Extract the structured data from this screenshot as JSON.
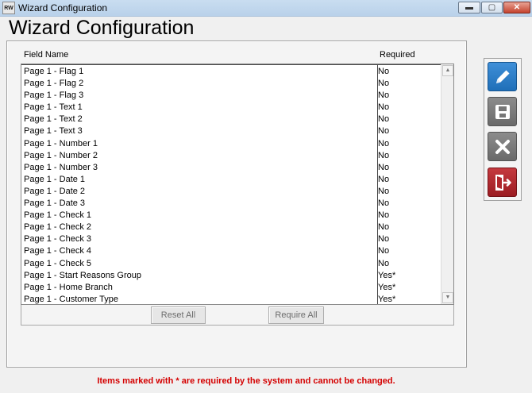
{
  "window": {
    "app_icon_text": "RW",
    "title": "Wizard Configuration",
    "controls": {
      "minimize": "▬",
      "maximize": "▢",
      "close": "✕"
    }
  },
  "page": {
    "heading": "Wizard Configuration"
  },
  "table": {
    "columns": {
      "field": "Field Name",
      "required": "Required"
    },
    "rows": [
      {
        "field": "Page 1 - Flag 1",
        "required": "No"
      },
      {
        "field": "Page 1 - Flag 2",
        "required": "No"
      },
      {
        "field": "Page 1 - Flag 3",
        "required": "No"
      },
      {
        "field": "Page 1 - Text 1",
        "required": "No"
      },
      {
        "field": "Page 1 - Text 2",
        "required": "No"
      },
      {
        "field": "Page 1 - Text 3",
        "required": "No"
      },
      {
        "field": "Page 1 - Number 1",
        "required": "No"
      },
      {
        "field": "Page 1 - Number 2",
        "required": "No"
      },
      {
        "field": "Page 1 - Number 3",
        "required": "No"
      },
      {
        "field": "Page 1 - Date 1",
        "required": "No"
      },
      {
        "field": "Page 1 - Date 2",
        "required": "No"
      },
      {
        "field": "Page 1 - Date 3",
        "required": "No"
      },
      {
        "field": "Page 1 - Check 1",
        "required": "No"
      },
      {
        "field": "Page 1 - Check 2",
        "required": "No"
      },
      {
        "field": "Page 1 - Check 3",
        "required": "No"
      },
      {
        "field": "Page 1 - Check 4",
        "required": "No"
      },
      {
        "field": "Page 1 - Check 5",
        "required": "No"
      },
      {
        "field": "Page 1 - Start Reasons Group",
        "required": "Yes*"
      },
      {
        "field": "Page 1 - Home Branch",
        "required": "Yes*"
      },
      {
        "field": "Page 1 - Customer Type",
        "required": "Yes*"
      }
    ]
  },
  "buttons": {
    "reset_all": "Reset All",
    "require_all": "Require All"
  },
  "toolbar": {
    "edit_icon": "pencil-icon",
    "save_icon": "floppy-disk-icon",
    "cancel_icon": "x-icon",
    "exit_icon": "exit-door-icon",
    "colors": {
      "edit": "#2a7cc7",
      "neutral": "#7a7a7a",
      "exit": "#b0262c"
    }
  },
  "footer": {
    "note": "Items marked with * are required by the system and cannot be changed."
  },
  "colors": {
    "note_text": "#d40000"
  }
}
